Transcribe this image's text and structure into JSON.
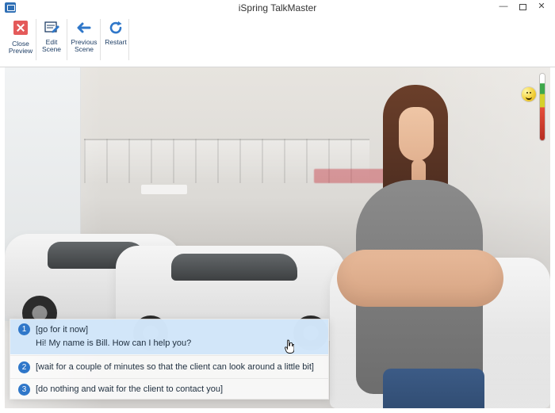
{
  "window": {
    "title": "iSpring TalkMaster"
  },
  "toolbar": {
    "buttons": [
      {
        "label_line1": "Close",
        "label_line2": "Preview",
        "icon": "close-preview-icon"
      },
      {
        "label_line1": "Edit",
        "label_line2": "Scene",
        "icon": "edit-scene-icon"
      },
      {
        "label_line1": "Previous",
        "label_line2": "Scene",
        "icon": "previous-scene-icon"
      },
      {
        "label_line1": "Restart",
        "label_line2": "",
        "icon": "restart-icon"
      }
    ]
  },
  "scene": {
    "mood_indicator": {
      "icon": "smiley-face-icon",
      "meter_colors": [
        "#3ea84b",
        "#d5d12a",
        "#e64f3a"
      ]
    },
    "choices": [
      {
        "number": "1",
        "line1": "[go for it now]",
        "line2": "Hi! My name is Bill. How can I help you?"
      },
      {
        "number": "2",
        "line1": "[wait for a couple of minutes so that the client can look around a little bit]"
      },
      {
        "number": "3",
        "line1": "[do nothing and wait for the client to contact you]"
      }
    ]
  },
  "colors": {
    "accent": "#2f77c9",
    "highlight_row": "#cee4f8",
    "close_icon": "#e45a5a"
  }
}
